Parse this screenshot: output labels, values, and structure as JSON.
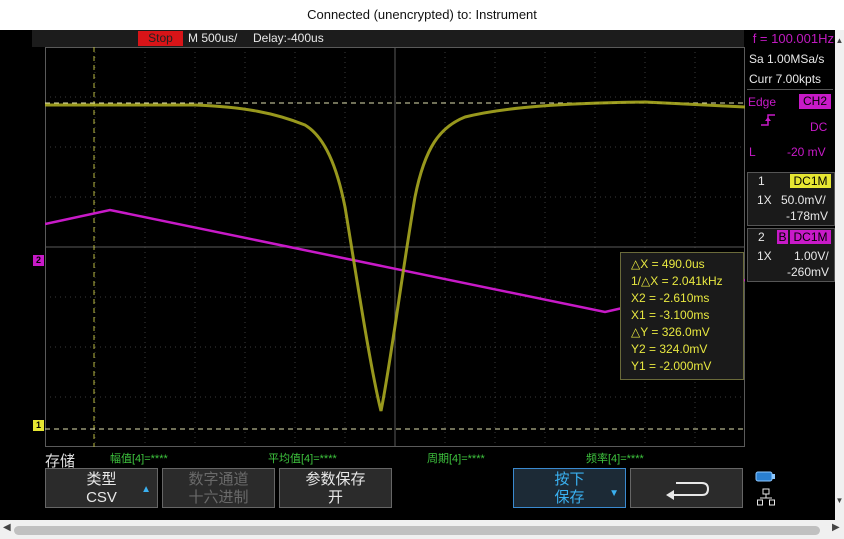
{
  "window": {
    "title": "Connected (unencrypted) to: Instrument"
  },
  "topbar": {
    "run_state": "Stop",
    "timebase": "M 500us/",
    "delay": "Delay:-400us",
    "frequency": "f = 100.001Hz"
  },
  "acquisition": {
    "sample_rate": "Sa 1.00MSa/s",
    "memory_depth": "Curr 7.00kpts"
  },
  "trigger": {
    "type": "Edge",
    "source": "CH2",
    "slope_icon": "rising-edge-icon",
    "coupling": "DC",
    "level_label": "L",
    "level": "-20 mV"
  },
  "channel1": {
    "number": "1",
    "coupling": "DC1M",
    "probe": "1X",
    "scale": "50.0mV/",
    "offset": "-178mV",
    "color": "#e6e632"
  },
  "channel2": {
    "number": "2",
    "bw_flag": "B",
    "coupling": "DC1M",
    "probe": "1X",
    "scale": "1.00V/",
    "offset": "-260mV",
    "color": "#c81ac8"
  },
  "cursor": {
    "dx": "△X = 490.0us",
    "inv_dx": "1/△X = 2.041kHz",
    "x2": "X2 = -2.610ms",
    "x1": "X1 = -3.100ms",
    "dy": "△Y = 326.0mV",
    "y2": "Y2 = 324.0mV",
    "y1": "Y1 = -2.000mV"
  },
  "markers": {
    "ch1": "1",
    "ch2": "2"
  },
  "measurements": [
    "幅值[4]=****",
    "平均值[4]=****",
    "周期[4]=****",
    "频率[4]=****"
  ],
  "menu": {
    "title": "存储",
    "keys": [
      {
        "line1": "类型",
        "line2": "CSV"
      },
      {
        "line1": "数字通道",
        "line2": "十六进制"
      },
      {
        "line1": "参数保存",
        "line2": "开"
      },
      {
        "line1": "按下",
        "line2": "保存"
      }
    ]
  },
  "icons": {
    "back": "return-arrow-icon",
    "usb": "usb-storage-icon",
    "network": "network-icon"
  }
}
